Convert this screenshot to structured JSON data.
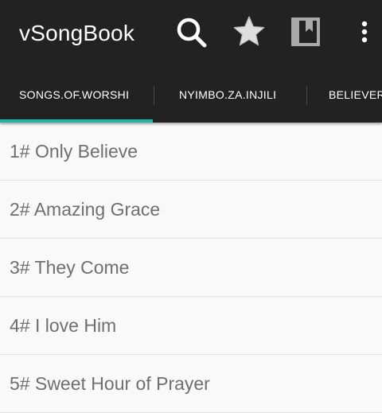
{
  "app": {
    "title": "vSongBook",
    "actions": {
      "search": "search-icon",
      "favorites": "star-icon",
      "bookmarks": "bookmark-icon",
      "overflow": "more-vert-icon"
    }
  },
  "tabs": [
    {
      "label": "SONGS.OF.WORSHI",
      "selected": true
    },
    {
      "label": "NYIMBO.ZA.INJILI",
      "selected": false
    },
    {
      "label": "BELIEVER",
      "selected": false
    }
  ],
  "songs": [
    {
      "label": "1# Only Believe"
    },
    {
      "label": "2# Amazing Grace"
    },
    {
      "label": "3# They Come"
    },
    {
      "label": "4# I love Him"
    },
    {
      "label": "5# Sweet Hour of Prayer"
    }
  ],
  "colors": {
    "toolbar": "#222222",
    "accent": "#1fb5a8",
    "list_bg": "#f9f9f9",
    "list_text": "#6f6f6f",
    "divider": "#e2e2e2"
  }
}
